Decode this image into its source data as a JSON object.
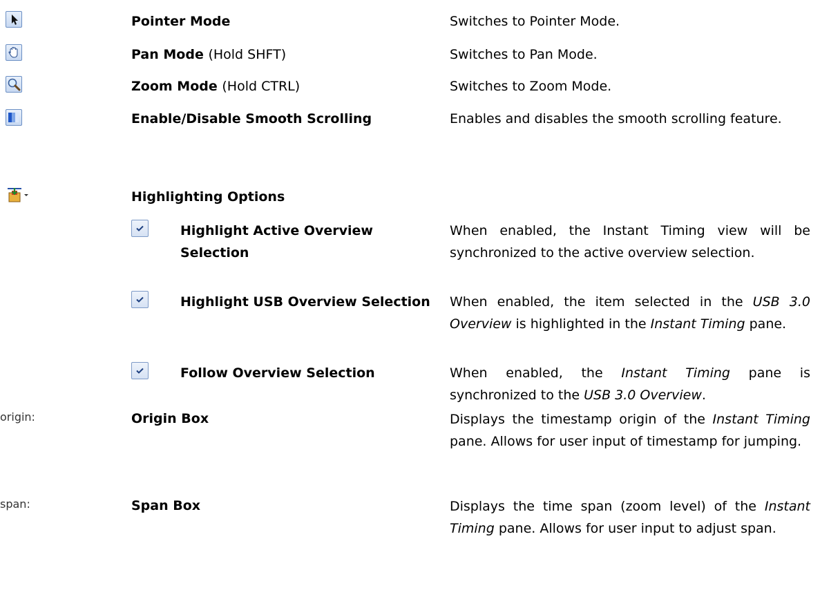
{
  "rows": [
    {
      "icon": "pointer-icon",
      "term": "Pointer Mode",
      "note": "",
      "desc": "Switches to Pointer Mode."
    },
    {
      "icon": "hand-icon",
      "term": "Pan Mode",
      "note": "(Hold SHFT)",
      "desc": "Switches to Pan Mode."
    },
    {
      "icon": "magnifier-icon",
      "term": "Zoom Mode",
      "note": "(Hold CTRL)",
      "desc": "Switches to Zoom Mode."
    },
    {
      "icon": "smooth-scroll-icon",
      "term": "Enable/Disable Smooth Scrolling",
      "desc": "Enables and disables the smooth scrolling feature."
    },
    {
      "icon": "highlight-options-icon",
      "term": "Highlighting Options"
    }
  ],
  "sub": [
    {
      "icon": "checkmark-icon",
      "term": "Highlight Active Overview Selection",
      "desc": "When enabled, the Instant Timing view will be synchronized to the active overview selection."
    },
    {
      "icon": "checkmark-icon",
      "term": "Highlight USB Overview Selection",
      "desc_parts": [
        "When enabled, the item selected in the ",
        "USB 3.0 Overview",
        " is highlighted in the ",
        "Instant Timing",
        " pane."
      ]
    },
    {
      "icon": "checkmark-icon",
      "term": "Follow Overview Selection",
      "desc_parts": [
        "When enabled, the ",
        "Instant Timing",
        " pane is synchronized to the ",
        "USB 3.0 Overview",
        "."
      ]
    }
  ],
  "boxes": [
    {
      "label": "origin:",
      "term": "Origin Box",
      "desc_parts": [
        "Displays the timestamp origin of the ",
        "Instant Timing",
        " pane.  Allows for user input of timestamp for jumping."
      ]
    },
    {
      "label": "span:",
      "term": "Span Box",
      "desc_parts": [
        "Displays the time span (zoom level) of the ",
        "Instant Timing",
        " pane.  Allows for user input to adjust span."
      ]
    }
  ]
}
